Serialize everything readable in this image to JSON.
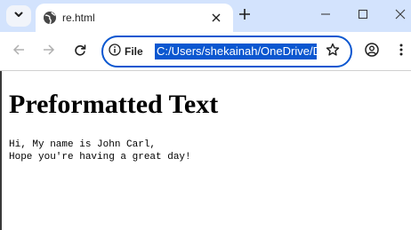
{
  "browser": {
    "tab": {
      "title": "re.html"
    },
    "address_bar": {
      "site_label": "File",
      "url": "C:/Users/shekainah/OneDrive/Desktop/re.html"
    }
  },
  "page": {
    "heading": "Preformatted Text",
    "preformatted": "Hi, My name is John Carl,\nHope you're having a great day!"
  },
  "colors": {
    "tabbar_bg": "#d3e3fd",
    "accent": "#0b57d0"
  }
}
